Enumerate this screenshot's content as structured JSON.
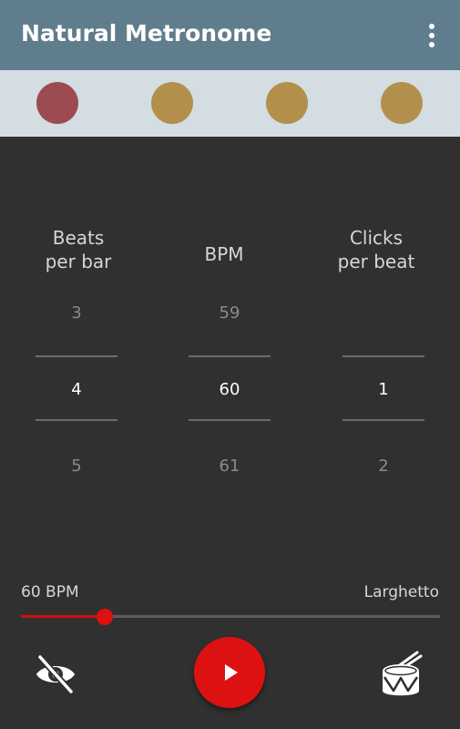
{
  "app_bar": {
    "title": "Natural Metronome",
    "overflow_icon": "more-vert-icon",
    "background": "#5f7d8c"
  },
  "beat_indicators": [
    {
      "state": "active",
      "color": "#9c4b52"
    },
    {
      "state": "inactive",
      "color": "#b2904c"
    },
    {
      "state": "inactive",
      "color": "#b2904c"
    },
    {
      "state": "inactive",
      "color": "#b2904c"
    }
  ],
  "pickers": {
    "beats_per_bar": {
      "header": "Beats\nper bar",
      "prev": "3",
      "current": "4",
      "next": "5"
    },
    "bpm": {
      "header": "BPM",
      "prev": "59",
      "current": "60",
      "next": "61"
    },
    "clicks_per_beat": {
      "header": "Clicks\nper beat",
      "prev": "",
      "current": "1",
      "next": "2"
    }
  },
  "tempo": {
    "value_label": "60 BPM",
    "name": "Larghetto",
    "slider_fraction": 0.2
  },
  "controls": {
    "hide_icon": "eye-off-icon",
    "play_icon": "play-icon",
    "drum_icon": "drum-icon"
  },
  "colors": {
    "accent": "#dd1111",
    "background": "#303030"
  }
}
